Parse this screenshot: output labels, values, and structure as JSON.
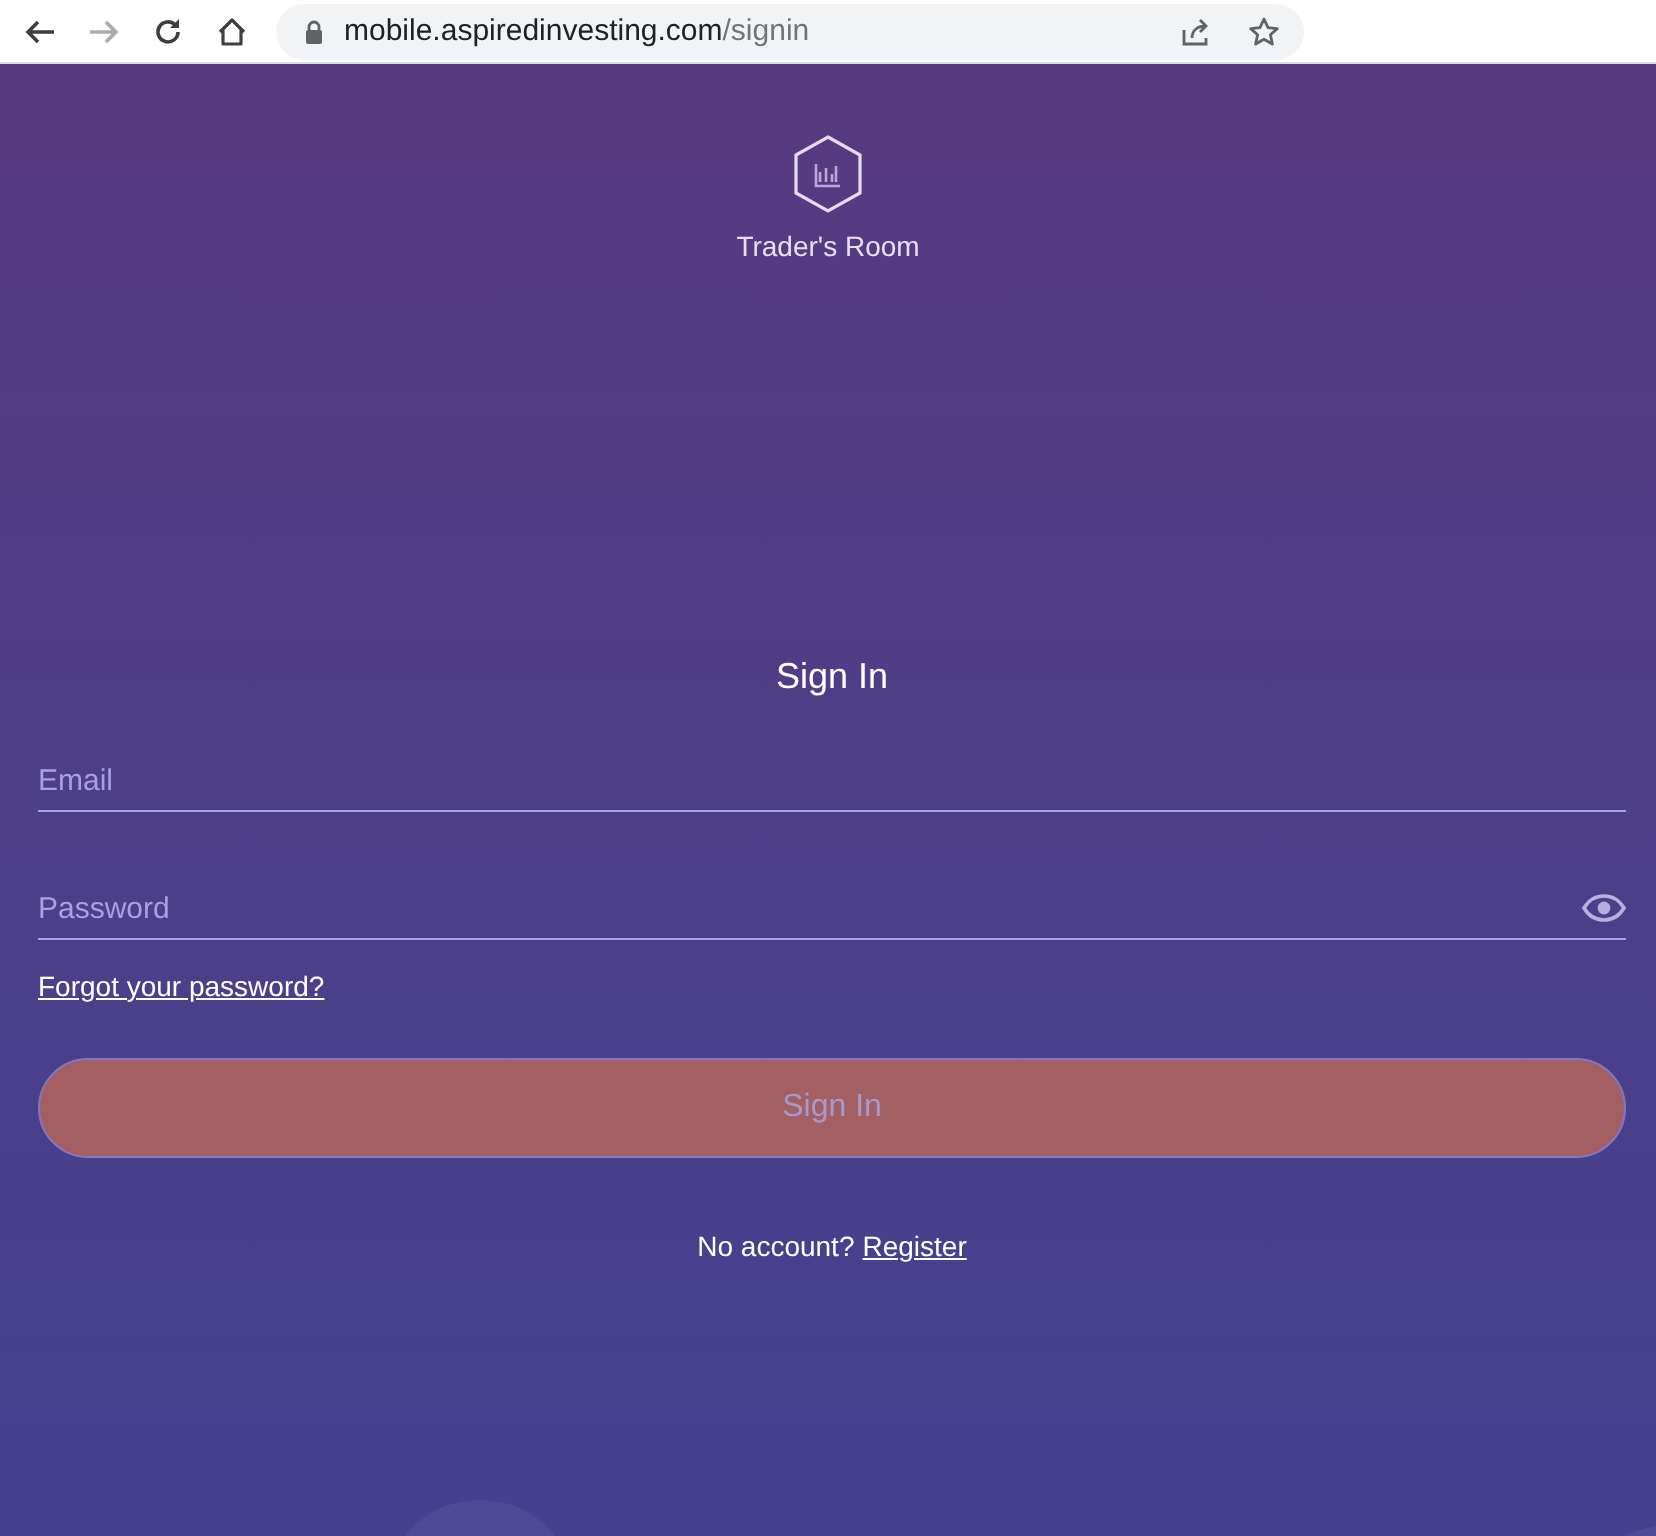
{
  "browser": {
    "nav": [
      {
        "kind": "back",
        "disabled": false
      },
      {
        "kind": "forward",
        "disabled": true
      },
      {
        "kind": "reload",
        "disabled": false
      },
      {
        "kind": "home",
        "disabled": false
      }
    ],
    "url": {
      "host": "mobile.aspiredinvesting.com",
      "path": "/signin"
    }
  },
  "brand": {
    "title": "Trader's Room"
  },
  "form": {
    "heading": "Sign In",
    "fields": [
      {
        "kind": "email",
        "placeholder": "Email"
      },
      {
        "kind": "password",
        "placeholder": "Password"
      }
    ],
    "forgot_link": "Forgot your password?",
    "submit": {
      "label": "Sign In",
      "disabled": true
    },
    "register_prompt": "No account?",
    "register_link": "Register"
  }
}
